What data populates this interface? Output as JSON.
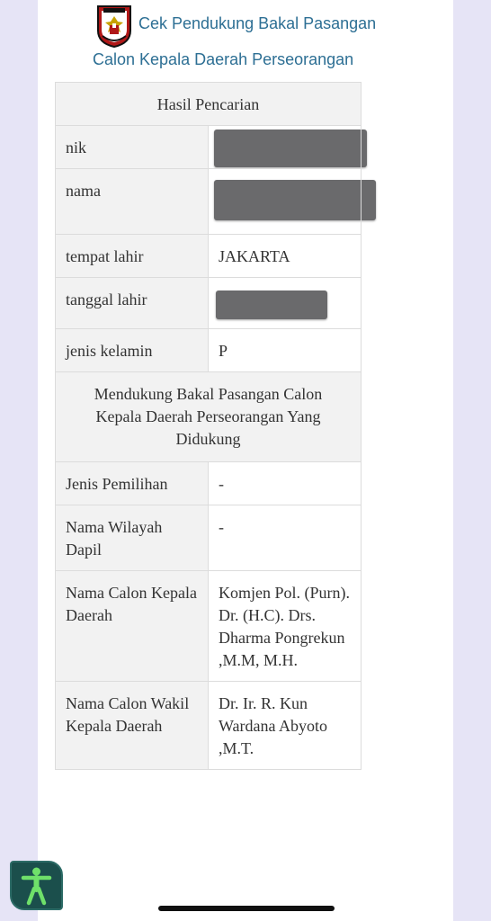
{
  "header": {
    "logo_lettering": [
      "KOMISI",
      "PEMILIHAN UMUM"
    ],
    "title_line1": "Cek Pendukung Bakal Pasangan",
    "title_line2": "Calon Kepala Daerah Perseorangan"
  },
  "result": {
    "heading": "Hasil Pencarian",
    "rows": [
      {
        "label": "nik",
        "value": "",
        "redacted": true
      },
      {
        "label": "nama",
        "value": "",
        "redacted": true
      },
      {
        "label": "tempat lahir",
        "value": "JAKARTA",
        "redacted": false
      },
      {
        "label": "tanggal lahir",
        "value": "",
        "redacted": true
      },
      {
        "label": "jenis kelamin",
        "value": "P",
        "redacted": false
      }
    ]
  },
  "support": {
    "heading": "Mendukung Bakal Pasangan Calon Kepala Daerah Perseorangan Yang Didukung",
    "rows": [
      {
        "label": "Jenis Pemilihan",
        "value": "-"
      },
      {
        "label": "Nama Wilayah Dapil",
        "value": "-"
      },
      {
        "label": "Nama Calon Kepala Daerah",
        "value": "Komjen Pol. (Purn). Dr. (H.C). Drs. Dharma Pongrekun ,M.M, M.H."
      },
      {
        "label": "Nama Calon Wakil Kepala Daerah",
        "value": "Dr. Ir. R. Kun Wardana Abyoto ,M.T."
      }
    ]
  },
  "accessibility": {
    "icon": "accessibility-person-icon"
  },
  "colors": {
    "background": "#e6e4f6",
    "title": "#2d6f94",
    "header_cell": "#f2f2f2",
    "redaction": "#6a6a6c",
    "a11y_button": "#1b4f4c"
  }
}
